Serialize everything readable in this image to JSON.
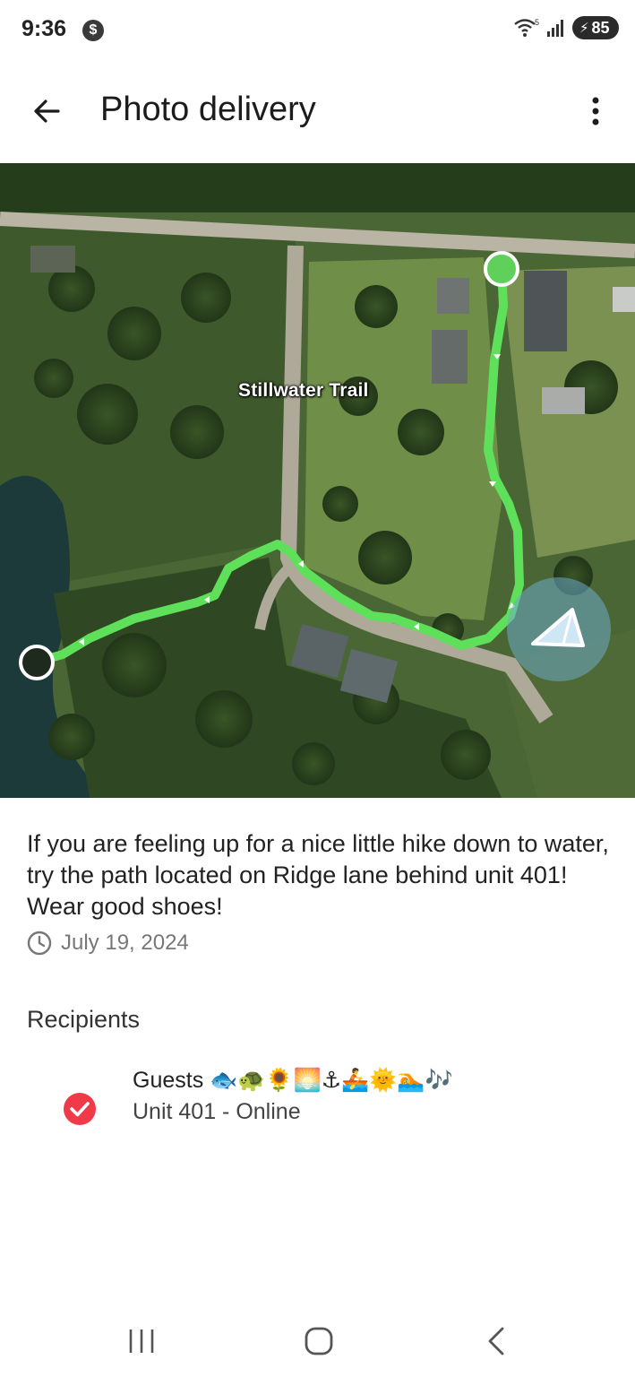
{
  "status_bar": {
    "time": "9:36",
    "notification_icon": "dollar-circle-icon",
    "wifi_badge": "5",
    "battery": "85"
  },
  "app_bar": {
    "title": "Photo delivery",
    "back_icon": "arrow-left-icon",
    "menu_icon": "more-vertical-icon"
  },
  "map": {
    "road_label": "Stillwater Trail",
    "route_color": "#5fe05a",
    "start_marker_color": "#5fd15a",
    "end_marker_color": "#1e2a1e"
  },
  "post": {
    "description": "If you are feeling up for a nice little hike down to water, try the path located on Ridge lane behind unit 401! Wear good shoes!",
    "date": "July 19, 2024"
  },
  "recipients": {
    "heading": "Recipients",
    "items": [
      {
        "name": "Guests 🐟🐢🌻🌅⚓🚣🌞🏊🎶",
        "detail": "Unit 401  - Online",
        "checked": true,
        "check_color": "#f03a4a"
      }
    ]
  },
  "nav": {
    "recent_icon": "recent-apps-icon",
    "home_icon": "home-icon",
    "back_icon": "nav-back-icon"
  }
}
